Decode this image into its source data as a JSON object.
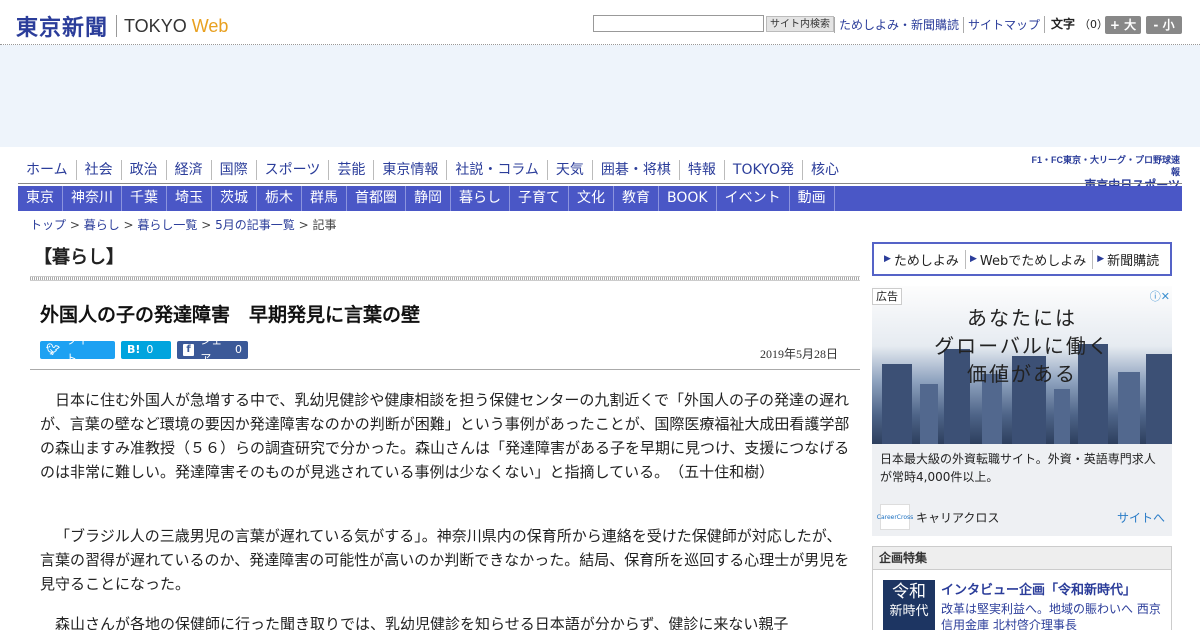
{
  "header": {
    "logo_jp": "東京新聞",
    "logo_en": "TOKYO",
    "logo_web": "Web",
    "search_button": "サイト内検索",
    "links": [
      "ためしよみ・新聞購読",
      "サイトマップ"
    ],
    "font_size_label": "文字",
    "font_size_value": "（0）",
    "font_plus": "+ 大",
    "font_minus": "- 小"
  },
  "nav_main": [
    "ホーム",
    "社会",
    "政治",
    "経済",
    "国際",
    "スポーツ",
    "芸能",
    "東京情報",
    "社説・コラム",
    "天気",
    "囲碁・将棋",
    "特報",
    "TOKYO発",
    "核心"
  ],
  "sponsor": {
    "line1": "F1・FC東京・大リーグ・プロ野球速報",
    "line2": "東京中日スポーツ"
  },
  "nav_region": [
    "東京",
    "神奈川",
    "千葉",
    "埼玉",
    "茨城",
    "栃木",
    "群馬",
    "首都圏",
    "静岡",
    "暮らし",
    "子育て",
    "文化",
    "教育",
    "BOOK",
    "イベント",
    "動画"
  ],
  "breadcrumb": {
    "items": [
      "トップ",
      "暮らし",
      "暮らし一覧",
      "5月の記事一覧"
    ],
    "current": "記事",
    "sep": " > "
  },
  "article": {
    "section": "【暮らし】",
    "headline": "外国人の子の発達障害　早期発見に言葉の壁",
    "share": {
      "tweet": "ツイート",
      "hatena_count": "0",
      "fb": "シェア",
      "fb_count": "0"
    },
    "date": "2019年5月28日",
    "paragraphs": [
      "日本に住む外国人が急増する中で、乳幼児健診や健康相談を担う保健センターの九割近くで「外国人の子の発達の遅れが、言葉の壁など環境の要因か発達障害なのかの判断が困難」という事例があったことが、国際医療福祉大成田看護学部の森山ますみ准教授（５６）らの調査研究で分かった。森山さんは「発達障害がある子を早期に見つけ、支援につなげるのは非常に難しい。発達障害そのものが見逃されている事例は少なくない」と指摘している。　（五十住和樹）",
      "「ブラジル人の三歳男児の言葉が遅れている気がする」。神奈川県内の保育所から連絡を受けた保健師が対応したが、言葉の習得が遅れているのか、発達障害の可能性が高いのか判断できなかった。結局、保育所を巡回する心理士が男児を見守ることになった。",
      "森山さんが各地の保健師に行った聞き取りでは、乳幼児健診を知らせる日本語が分からず、健診に来ない親子"
    ]
  },
  "sidebar": {
    "links": [
      "ためしよみ",
      "Webでためしよみ",
      "新聞購読"
    ],
    "ad": {
      "tag": "広告",
      "copy": [
        "あなたには",
        "グローバルに働く",
        "価値がある"
      ],
      "text": "日本最大級の外資転職サイト。外資・英語専門求人が常時4,000件以上。",
      "advertiser": "キャリアクロス",
      "logo_text": "CareerCross",
      "link": "サイトへ"
    },
    "feature": {
      "heading": "企画特集",
      "thumb": [
        "令和",
        "新時代"
      ],
      "title": "インタビュー企画「令和新時代」",
      "sub": "改革は堅実利益へ。地域の賑わいへ 西京信用金庫 北村啓介理事長"
    }
  },
  "colors": {
    "brand": "#2b3d9a",
    "nav_bar": "#4a57c6",
    "twitter": "#1da1f2",
    "hatena": "#00a4de",
    "facebook": "#3b5998",
    "web_accent": "#e8a020"
  }
}
